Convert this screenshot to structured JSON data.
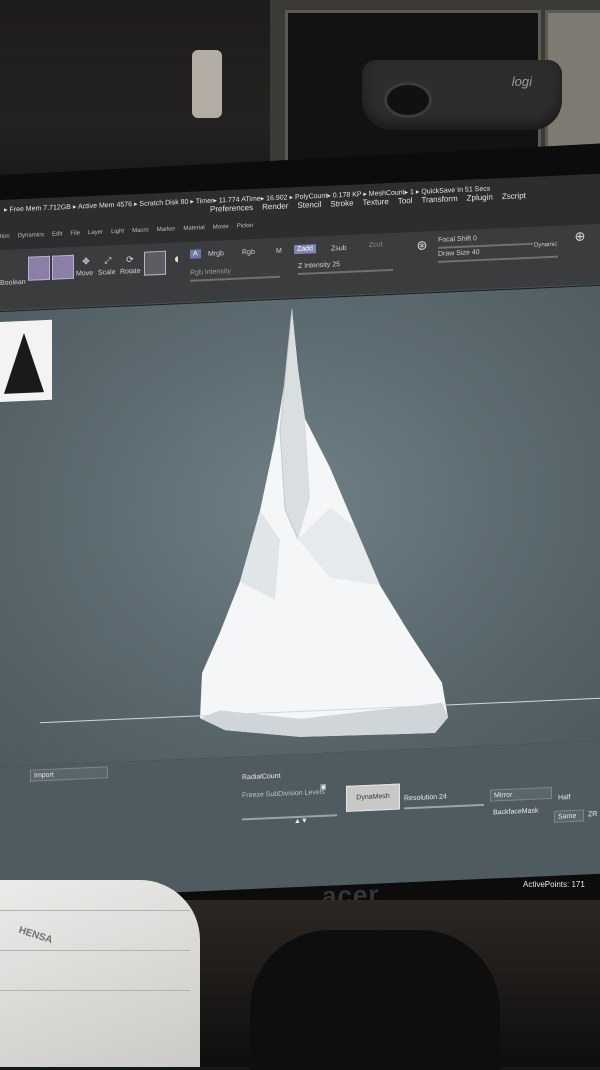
{
  "app": {
    "status_line": "▸ Free Mem 7.712GB ▸ Active Mem 4576 ▸ Scratch Disk 80 ▸ Timer▸ 11.774 ATime▸ 16.902 ▸ PolyCount▸ 0.178 KP ▸ MeshCount▸ 1 ▸ QuickSave In 51 Secs",
    "menu": [
      "Preferences",
      "Render",
      "Stencil",
      "Stroke",
      "Texture",
      "Tool",
      "Transform",
      "Zplugin",
      "Zscript"
    ],
    "submenu": [
      "tion",
      "Dynamics",
      "Edit",
      "File",
      "Layer",
      "Light",
      "Macro",
      "Marker",
      "Material",
      "Movie",
      "Picker"
    ]
  },
  "toolbar": {
    "boolean_label": "Boolean",
    "move_label": "Move",
    "scale_label": "Scale",
    "rotate_label": "Rotate",
    "a_chip": "A",
    "mrgb": "Mrgb",
    "rgb": "Rgb",
    "m": "M",
    "zadd": "Zadd",
    "zsub": "Zsub",
    "zcut": "Zcut",
    "rgb_intensity": "Rgb Intensity",
    "z_intensity": "Z Intensity 25",
    "focal_shift": "Focal Shift 0",
    "draw_size": "Draw Size 40",
    "dynamic": "Dynamic"
  },
  "bottom_panel": {
    "import_label": "Import",
    "radial_count": "RadialCount",
    "freeze_subdiv": "Freeze SubDivision Levels",
    "dynamesh_button": "DynaMesh",
    "resolution": "Resolution 24",
    "mirror": "Mirror",
    "half": "Half",
    "backface_mask": "BackfaceMask",
    "same": "Same",
    "za": "ZR"
  },
  "status": {
    "active_points": "ActivePoints: 171"
  },
  "hardware": {
    "webcam_brand": "logi",
    "monitor_brand": "acer",
    "mask_text": "HENSA"
  },
  "colors": {
    "viewport_center": "#6e7f85",
    "mesh": "#f4f6f7",
    "dynamesh_button": "#c9c8c8",
    "tool_highlight": "#8b7fa7"
  }
}
